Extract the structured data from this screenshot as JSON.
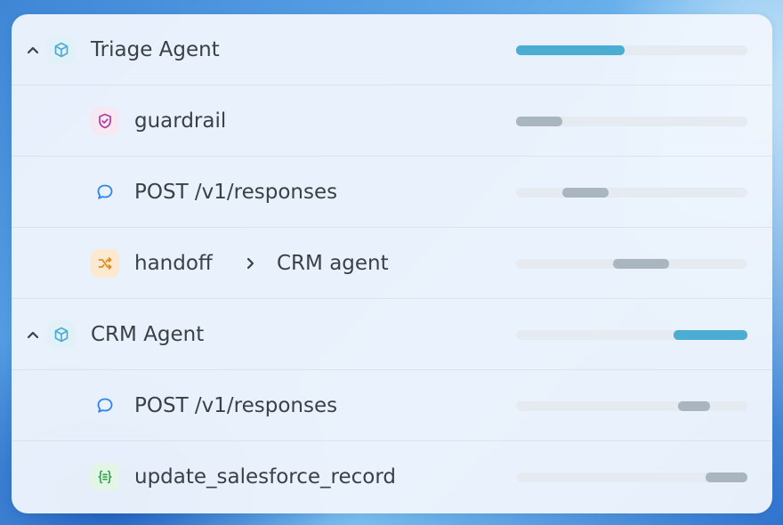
{
  "trace": {
    "rows": [
      {
        "kind": "agent",
        "label": "Triage Agent",
        "icon": "cube-icon",
        "expanded": true,
        "bar": {
          "start": 0.0,
          "end": 0.47
        }
      },
      {
        "kind": "guardrail",
        "label": "guardrail",
        "icon": "shield-check-icon",
        "bar": {
          "start": 0.0,
          "end": 0.2
        }
      },
      {
        "kind": "response",
        "label": "POST /v1/responses",
        "icon": "chat-bubble-icon",
        "bar": {
          "start": 0.2,
          "end": 0.4
        }
      },
      {
        "kind": "handoff",
        "label": "handoff",
        "target": "CRM agent",
        "icon": "shuffle-icon",
        "bar": {
          "start": 0.42,
          "end": 0.66
        }
      },
      {
        "kind": "agent",
        "label": "CRM Agent",
        "icon": "cube-icon",
        "expanded": true,
        "bar": {
          "start": 0.68,
          "end": 1.0
        }
      },
      {
        "kind": "response",
        "label": "POST /v1/responses",
        "icon": "chat-bubble-icon",
        "bar": {
          "start": 0.7,
          "end": 0.84
        }
      },
      {
        "kind": "function",
        "label": "update_salesforce_record",
        "icon": "function-braces-icon",
        "bar": {
          "start": 0.82,
          "end": 1.0
        }
      }
    ]
  },
  "colors": {
    "agent_bar": "#4aadd1",
    "span_bar": "#a9b6bf",
    "track": "#e6ebf1",
    "agent_icon": "#4aadd1",
    "guardrail_icon": "#b53aa0",
    "response_icon": "#2f84f0",
    "handoff_icon": "#e08a1e",
    "function_icon": "#2fa34d"
  }
}
